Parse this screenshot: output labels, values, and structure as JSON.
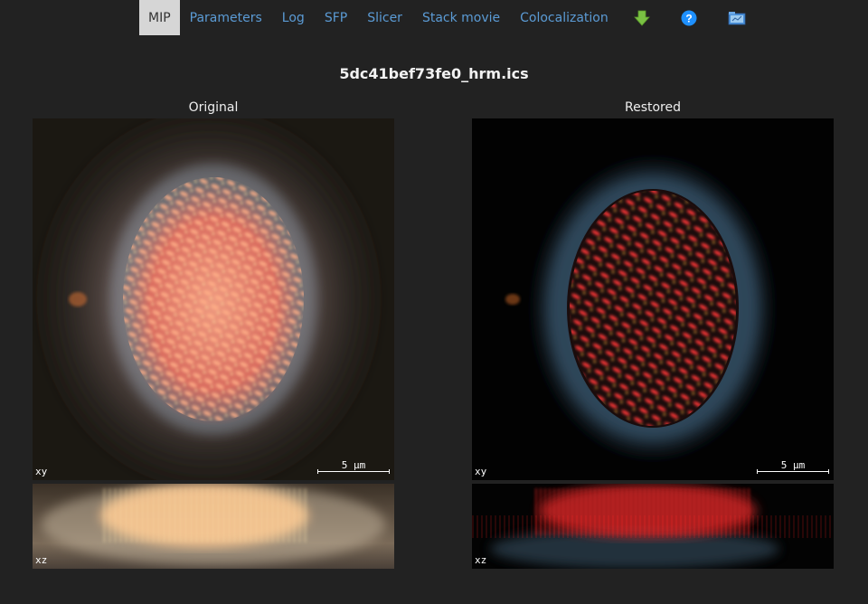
{
  "nav": {
    "items": [
      {
        "label": "MIP",
        "active": true
      },
      {
        "label": "Parameters"
      },
      {
        "label": "Log"
      },
      {
        "label": "SFP"
      },
      {
        "label": "Slicer"
      },
      {
        "label": "Stack movie"
      },
      {
        "label": "Colocalization"
      }
    ],
    "icons": [
      "download-arrow-icon",
      "help-icon",
      "folder-icon"
    ]
  },
  "title": "5dc41bef73fe0_hrm.ics",
  "panels": {
    "original": {
      "label": "Original",
      "xy_label": "xy",
      "xz_label": "xz",
      "scale_label": "5 µm"
    },
    "restored": {
      "label": "Restored",
      "xy_label": "xy",
      "xz_label": "xz",
      "scale_label": "5 µm"
    }
  },
  "colors": {
    "background": "#222222",
    "link": "#5b9bd5",
    "active_tab_bg": "#d6d6d6",
    "download_green": "#7ac143",
    "help_blue": "#1e90ff"
  }
}
